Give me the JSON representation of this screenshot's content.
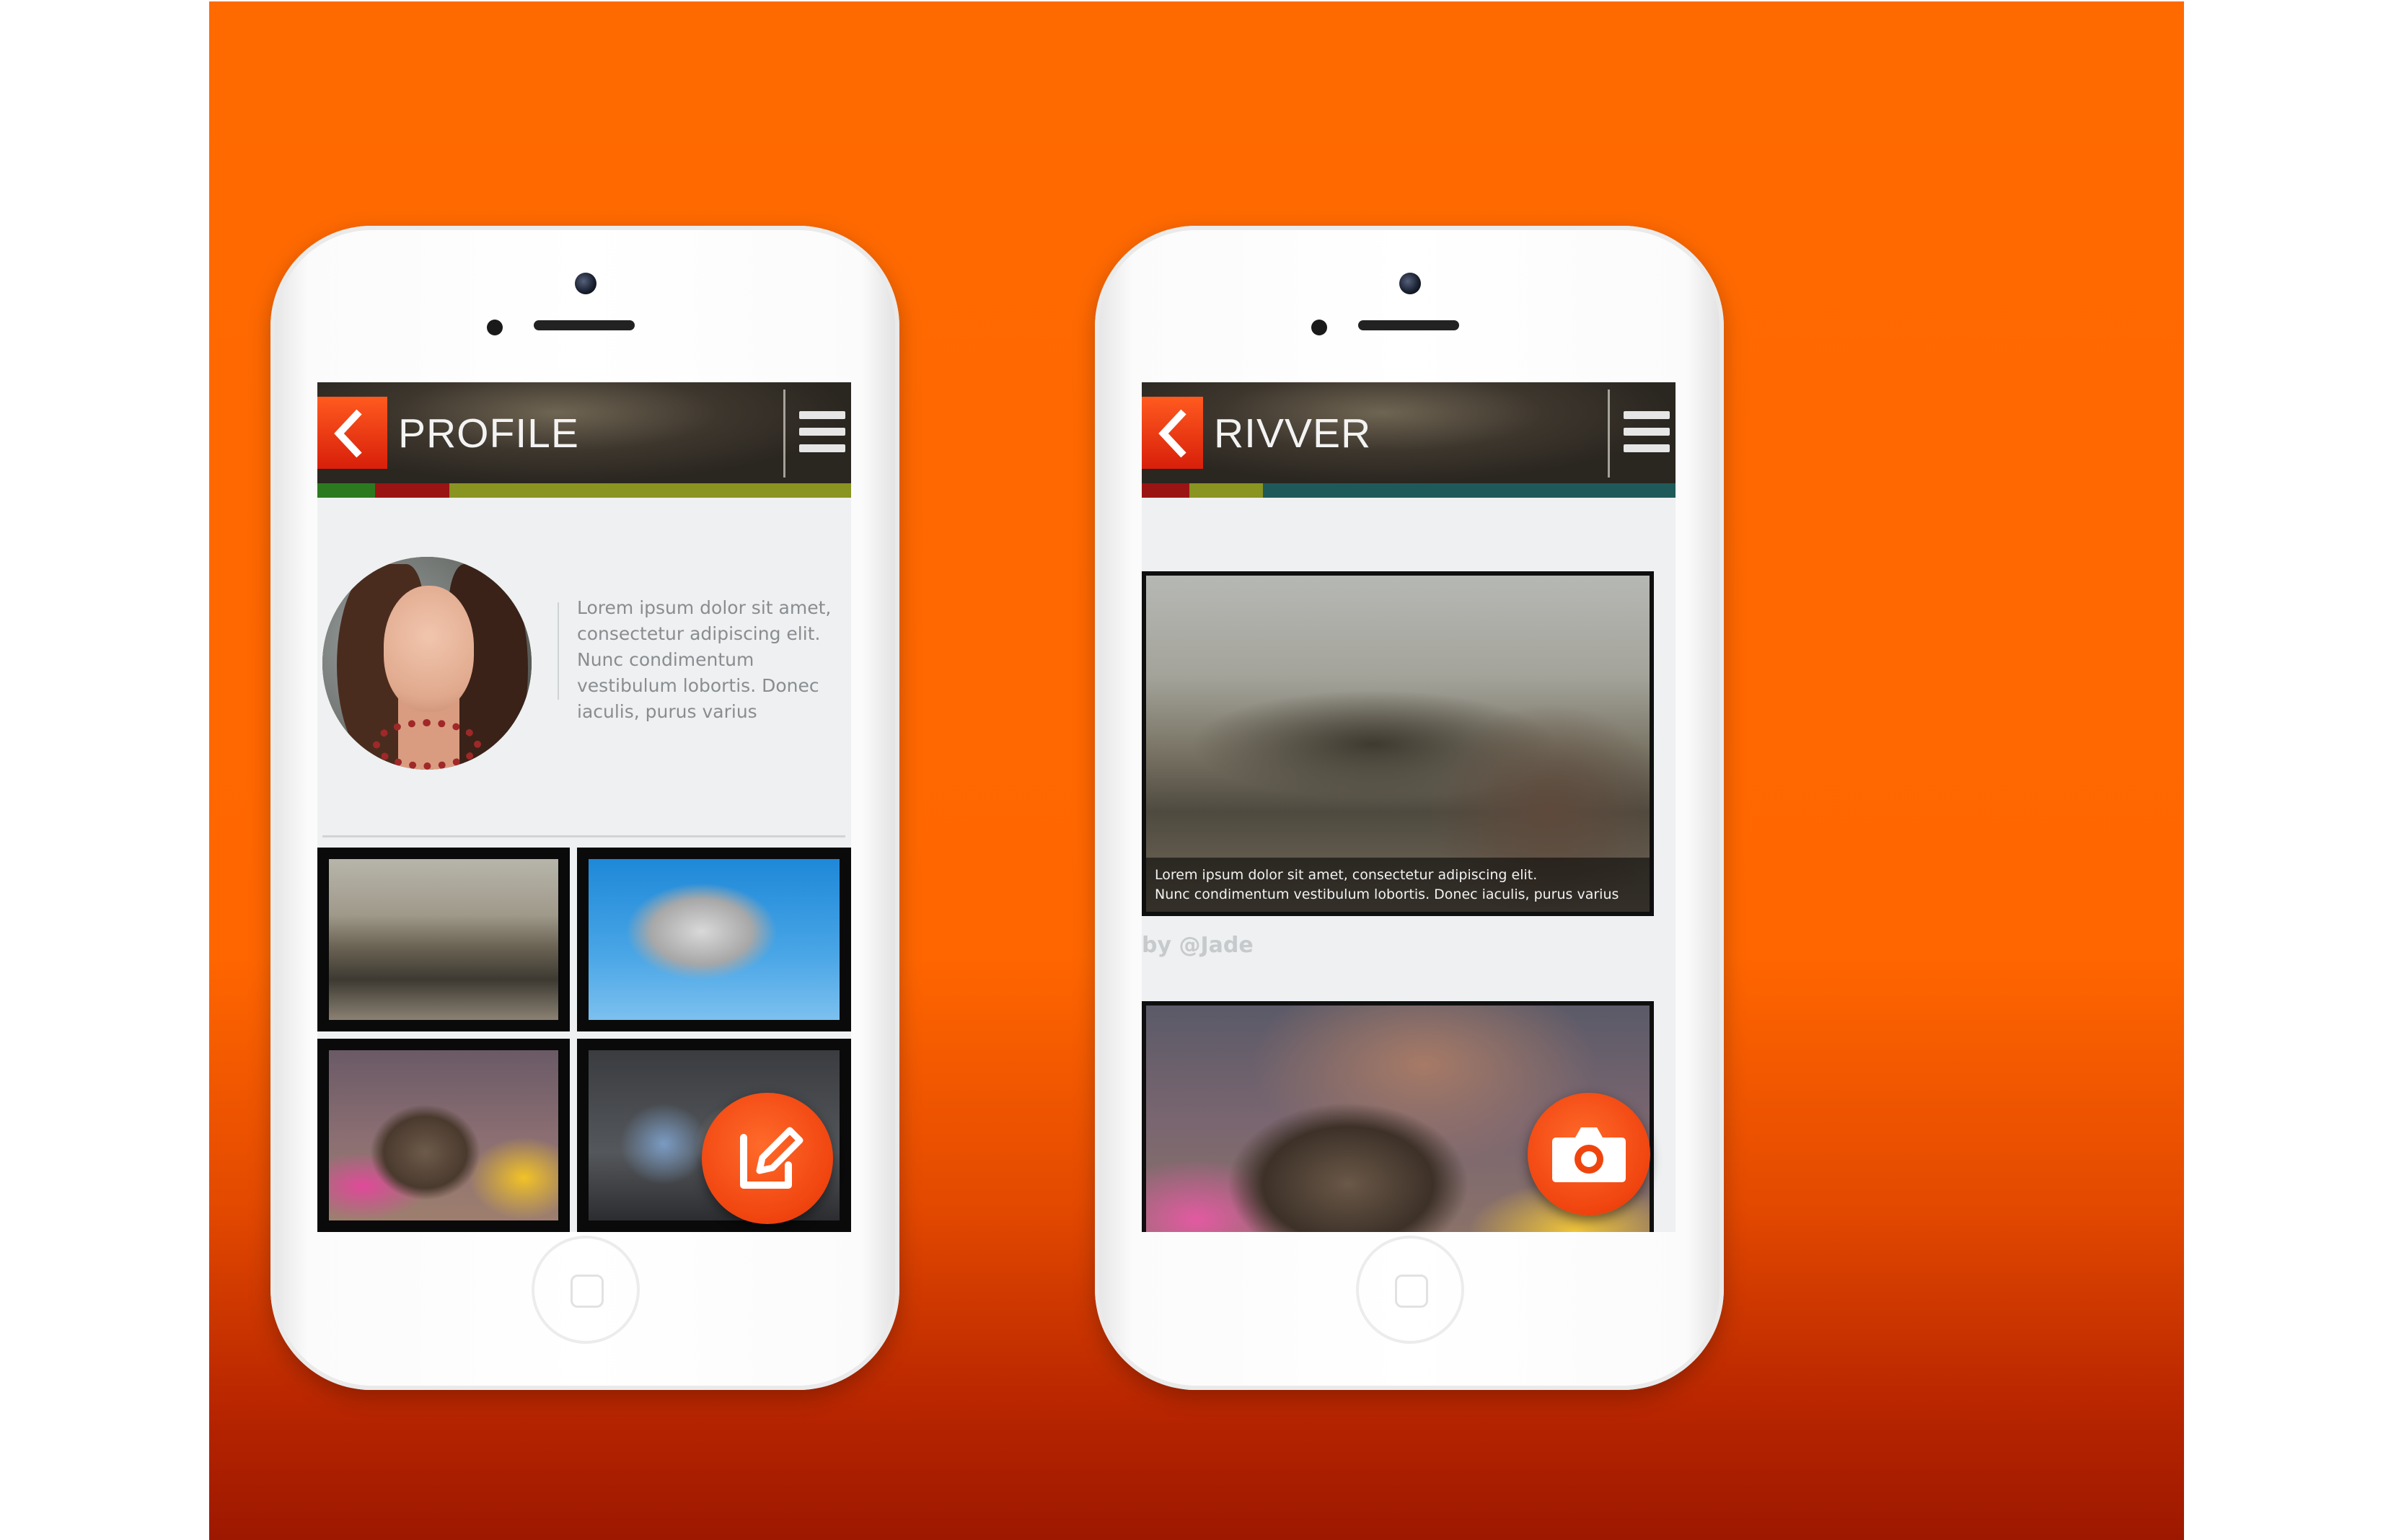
{
  "screens": {
    "profile": {
      "title": "PROFILE",
      "stripe_colors": [
        "#2b7a1f",
        "#9b1414",
        "#8a9420"
      ],
      "bio": "Lorem ipsum dolor sit amet, consectetur adipiscing elit. Nunc condimentum vestibulum lobortis. Donec iaculis, purus varius",
      "fab_icon": "edit-icon"
    },
    "rivver": {
      "title": "RIVVER",
      "stripe_colors": [
        "#9b1414",
        "#8a9420",
        "#1f5a5a"
      ],
      "caption_line1": "Lorem ipsum dolor sit amet, consectetur adipiscing elit.",
      "caption_line2": "Nunc condimentum vestibulum lobortis. Donec iaculis, purus varius",
      "byline": "by @Jade",
      "fab_icon": "camera-icon"
    }
  },
  "icons": {
    "back": "back-chevron-icon",
    "menu": "hamburger-menu-icon"
  },
  "colors": {
    "background_top": "#ff6600",
    "background_bottom": "#9d1800",
    "accent": "#f0440f"
  }
}
